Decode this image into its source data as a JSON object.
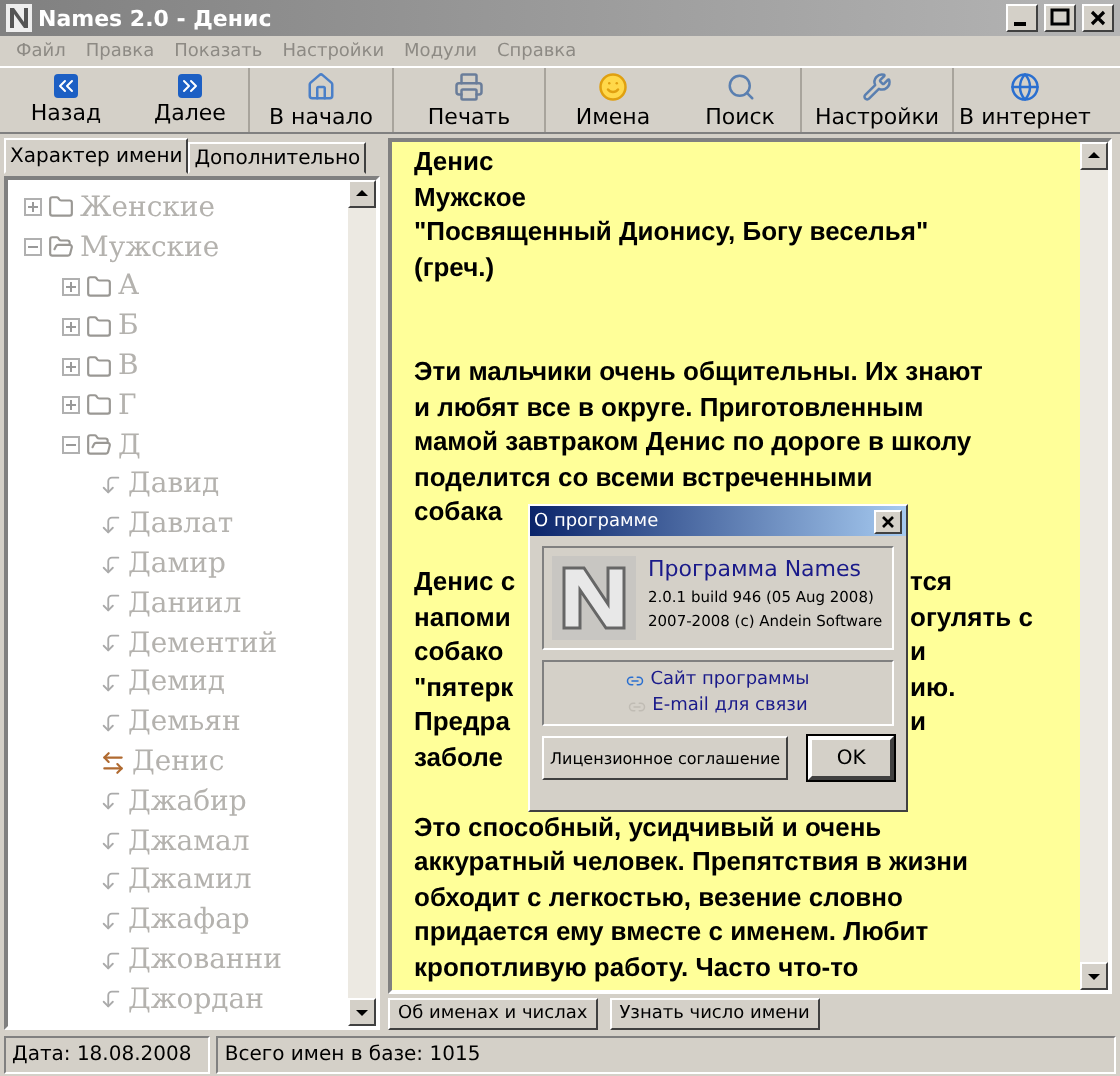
{
  "window": {
    "title": "Names 2.0 - Денис"
  },
  "menu": [
    {
      "label": "Файл",
      "disabled": true
    },
    {
      "label": "Правка",
      "disabled": true
    },
    {
      "label": "Показать",
      "disabled": true
    },
    {
      "label": "Настройки",
      "disabled": true
    },
    {
      "label": "Модули",
      "disabled": true
    },
    {
      "label": "Справка",
      "disabled": true
    }
  ],
  "toolbar": [
    {
      "label": "Назад"
    },
    {
      "label": "Далее"
    },
    {
      "label": "В начало"
    },
    {
      "label": "Печать"
    },
    {
      "label": "Имена"
    },
    {
      "label": "Поиск"
    },
    {
      "label": "Настройки"
    },
    {
      "label": "В интернет"
    }
  ],
  "tabs": [
    {
      "label": "Характер имени",
      "selected": true
    },
    {
      "label": "Дополнительно",
      "selected": false
    }
  ],
  "tree": [
    {
      "kind": "folder",
      "label": "Женские",
      "expanded": false
    },
    {
      "kind": "folder",
      "label": "Мужские",
      "expanded": true,
      "children": [
        {
          "kind": "folder",
          "label": "А",
          "expanded": false
        },
        {
          "kind": "folder",
          "label": "Б",
          "expanded": false
        },
        {
          "kind": "folder",
          "label": "В",
          "expanded": false
        },
        {
          "kind": "folder",
          "label": "Г",
          "expanded": false
        },
        {
          "kind": "folder",
          "label": "Д",
          "expanded": true,
          "children": [
            {
              "kind": "name",
              "label": "Давид",
              "selected": false
            },
            {
              "kind": "name",
              "label": "Давлат",
              "selected": false
            },
            {
              "kind": "name",
              "label": "Дамир",
              "selected": false
            },
            {
              "kind": "name",
              "label": "Даниил",
              "selected": false
            },
            {
              "kind": "name",
              "label": "Дементий",
              "selected": false
            },
            {
              "kind": "name",
              "label": "Демид",
              "selected": false
            },
            {
              "kind": "name",
              "label": "Демьян",
              "selected": false
            },
            {
              "kind": "name",
              "label": "Денис",
              "selected": true
            },
            {
              "kind": "name",
              "label": "Джабир",
              "selected": false
            },
            {
              "kind": "name",
              "label": "Джамал",
              "selected": false
            },
            {
              "kind": "name",
              "label": "Джамил",
              "selected": false
            },
            {
              "kind": "name",
              "label": "Джафар",
              "selected": false
            },
            {
              "kind": "name",
              "label": "Джованни",
              "selected": false
            },
            {
              "kind": "name",
              "label": "Джордан",
              "selected": false
            }
          ]
        }
      ]
    }
  ],
  "article": [
    {
      "kind": "text",
      "text": "Денис"
    },
    {
      "kind": "text",
      "text": "Мужское"
    },
    {
      "kind": "text",
      "text": "\"Посвященный Дионису, Богу веселья\""
    },
    {
      "kind": "text",
      "text": "(греч.)"
    },
    {
      "kind": "blank"
    },
    {
      "kind": "blank"
    },
    {
      "kind": "text",
      "text": "Эти мальчики очень общительны. Их знают"
    },
    {
      "kind": "text",
      "text": "и любят все в округе. Приготовленным"
    },
    {
      "kind": "text",
      "text": "мамой завтраком Денис по дороге в школу"
    },
    {
      "kind": "text",
      "text": "поделится со всеми встреченными"
    },
    {
      "kind": "split",
      "left": "собака"
    },
    {
      "kind": "blank"
    },
    {
      "kind": "split",
      "left": "Денис с",
      "right": "тся"
    },
    {
      "kind": "split",
      "left": "напоми",
      "right": "огулять с"
    },
    {
      "kind": "split",
      "left": "собако",
      "right": "и"
    },
    {
      "kind": "split",
      "left": "\"пятерк",
      "right": "ию."
    },
    {
      "kind": "split",
      "left": "Предра",
      "right": "и"
    },
    {
      "kind": "split",
      "left": "заболе"
    },
    {
      "kind": "blank"
    },
    {
      "kind": "text",
      "text": "Это способный, усидчивый и очень"
    },
    {
      "kind": "text",
      "text": "аккуратный человек. Препятствия в жизни"
    },
    {
      "kind": "text",
      "text": "обходит с легкостью, везение словно"
    },
    {
      "kind": "text",
      "text": "придается ему вместе с именем. Любит"
    },
    {
      "kind": "text",
      "text": "кропотливую работу. Часто что-то"
    }
  ],
  "bottom_buttons": [
    "Об именах и числах",
    "Узнать число имени"
  ],
  "status_bar": [
    "Дата: 18.08.2008",
    "Всего имен в базе: 1015"
  ],
  "dialog": {
    "title": "О программе",
    "product": "Программа Names",
    "version": "2.0.1 build 946 (05 Aug 2008)",
    "copyright": "2007-2008 (c) Andein Software",
    "links": [
      {
        "label": "Сайт программы",
        "selected": true
      },
      {
        "label": "E-mail для связи",
        "selected": false
      }
    ],
    "buttons": [
      {
        "label": "Лицензионное соглашение",
        "default": false
      },
      {
        "label": "OK",
        "default": true
      }
    ]
  }
}
